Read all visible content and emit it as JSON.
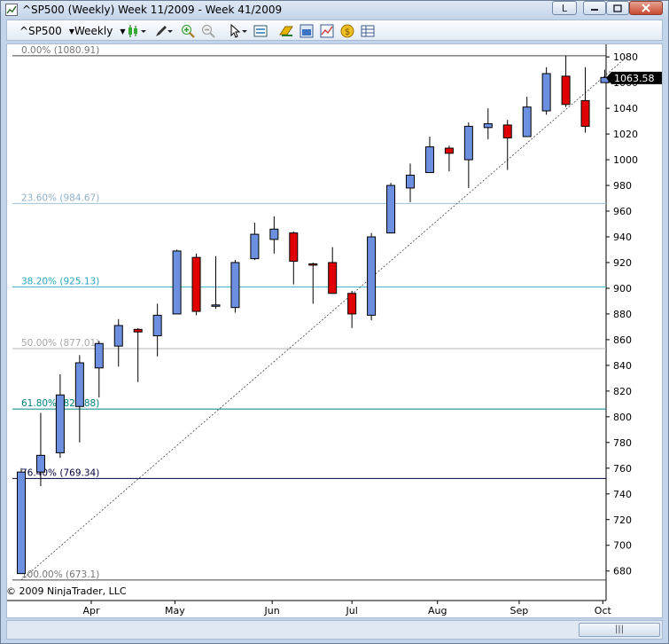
{
  "window": {
    "title": "^SP500 (Weekly)  Week 11/2009 - Week 41/2009",
    "btn_l": "L"
  },
  "toolbar": {
    "instrument": "^SP500",
    "interval": "Weekly",
    "icons": [
      "candlestick-icon",
      "pencil-icon",
      "zoom-in-icon",
      "zoom-out-icon",
      "pointer-icon",
      "data-box-icon",
      "strategy-icon",
      "properties-icon",
      "indicators-icon",
      "coin-icon",
      "grid-icon"
    ]
  },
  "copyright": "© 2009 NinjaTrader, LLC",
  "scrollbar_grip": "|||",
  "colors": {
    "up": "#6d8fe0",
    "down": "#e00000",
    "fib_0": "#444444",
    "fib_236": "#9fc3d9",
    "fib_382": "#46b6c8",
    "fib_50": "#b5b5b5",
    "fib_618": "#008080",
    "fib_764": "#000040",
    "fib_100": "#444444"
  },
  "chart_data": {
    "type": "candlestick",
    "ylim": [
      666,
      1087
    ],
    "y_ticks": [
      680,
      700,
      720,
      740,
      760,
      780,
      800,
      820,
      840,
      860,
      880,
      900,
      920,
      940,
      960,
      980,
      1000,
      1020,
      1040,
      1060,
      1080
    ],
    "last_price": "1063.58",
    "x_ticks": [
      {
        "label": "Apr",
        "week": 3.6
      },
      {
        "label": "May",
        "week": 7.9
      },
      {
        "label": "Jun",
        "week": 12.9
      },
      {
        "label": "Jul",
        "week": 17.0
      },
      {
        "label": "Aug",
        "week": 21.4
      },
      {
        "label": "Sep",
        "week": 25.6
      },
      {
        "label": "Oct",
        "week": 29.9
      }
    ],
    "fib_levels": [
      {
        "label": "0.00% (1080.91)",
        "value": 1080.91,
        "color_key": "fib_0",
        "label_color": "#777777"
      },
      {
        "label": "23.60% (984.67)",
        "value": 966,
        "color_key": "fib_236",
        "label_color": "#8fb0c8"
      },
      {
        "label": "38.20% (925.13)",
        "value": 901,
        "color_key": "fib_382",
        "label_color": "#2aa7bd"
      },
      {
        "label": "50.00% (877.01)",
        "value": 853,
        "color_key": "fib_50",
        "label_color": "#a8a8a8"
      },
      {
        "label": "61.80% (828.88)",
        "value": 806,
        "color_key": "fib_618",
        "label_color": "#008080"
      },
      {
        "label": "76.40% (769.34)",
        "value": 752,
        "color_key": "fib_764",
        "label_color": "#000040"
      },
      {
        "label": "100.00% (673.1)",
        "value": 673,
        "color_key": "fib_100",
        "label_color": "#777777"
      }
    ],
    "trendline": {
      "from": {
        "week": 0,
        "value": 673
      },
      "to": {
        "week": 31.2,
        "value": 1080.91
      }
    },
    "candles": [
      {
        "o": 678,
        "h": 760,
        "l": 678,
        "c": 757
      },
      {
        "o": 757,
        "h": 803,
        "l": 746,
        "c": 770
      },
      {
        "o": 772,
        "h": 833,
        "l": 768,
        "c": 817
      },
      {
        "o": 808,
        "h": 848,
        "l": 780,
        "c": 842
      },
      {
        "o": 838,
        "h": 859,
        "l": 815,
        "c": 857
      },
      {
        "o": 855,
        "h": 876,
        "l": 839,
        "c": 871
      },
      {
        "o": 868,
        "h": 869,
        "l": 827,
        "c": 866
      },
      {
        "o": 863,
        "h": 888,
        "l": 847,
        "c": 879
      },
      {
        "o": 880,
        "h": 930,
        "l": 880,
        "c": 929
      },
      {
        "o": 924,
        "h": 927,
        "l": 879,
        "c": 882
      },
      {
        "o": 886,
        "h": 925,
        "l": 884,
        "c": 887
      },
      {
        "o": 885,
        "h": 922,
        "l": 881,
        "c": 920
      },
      {
        "o": 923,
        "h": 951,
        "l": 922,
        "c": 942
      },
      {
        "o": 938,
        "h": 956,
        "l": 927,
        "c": 946
      },
      {
        "o": 943,
        "h": 944,
        "l": 903,
        "c": 921
      },
      {
        "o": 919,
        "h": 920,
        "l": 888,
        "c": 918
      },
      {
        "o": 920,
        "h": 932,
        "l": 897,
        "c": 896
      },
      {
        "o": 896,
        "h": 898,
        "l": 869,
        "c": 880
      },
      {
        "o": 879,
        "h": 943,
        "l": 875,
        "c": 940
      },
      {
        "o": 943,
        "h": 982,
        "l": 943,
        "c": 980
      },
      {
        "o": 978,
        "h": 997,
        "l": 967,
        "c": 988
      },
      {
        "o": 990,
        "h": 1018,
        "l": 990,
        "c": 1010
      },
      {
        "o": 1009,
        "h": 1011,
        "l": 991,
        "c": 1005
      },
      {
        "o": 1000,
        "h": 1029,
        "l": 978,
        "c": 1026
      },
      {
        "o": 1025,
        "h": 1040,
        "l": 1016,
        "c": 1028
      },
      {
        "o": 1027,
        "h": 1031,
        "l": 992,
        "c": 1017
      },
      {
        "o": 1018,
        "h": 1049,
        "l": 1018,
        "c": 1041
      },
      {
        "o": 1038,
        "h": 1072,
        "l": 1035,
        "c": 1067
      },
      {
        "o": 1065,
        "h": 1081,
        "l": 1041,
        "c": 1043
      },
      {
        "o": 1046,
        "h": 1072,
        "l": 1021,
        "c": 1026
      },
      {
        "o": 1060,
        "h": 1070,
        "l": 1060,
        "c": 1064
      }
    ]
  }
}
